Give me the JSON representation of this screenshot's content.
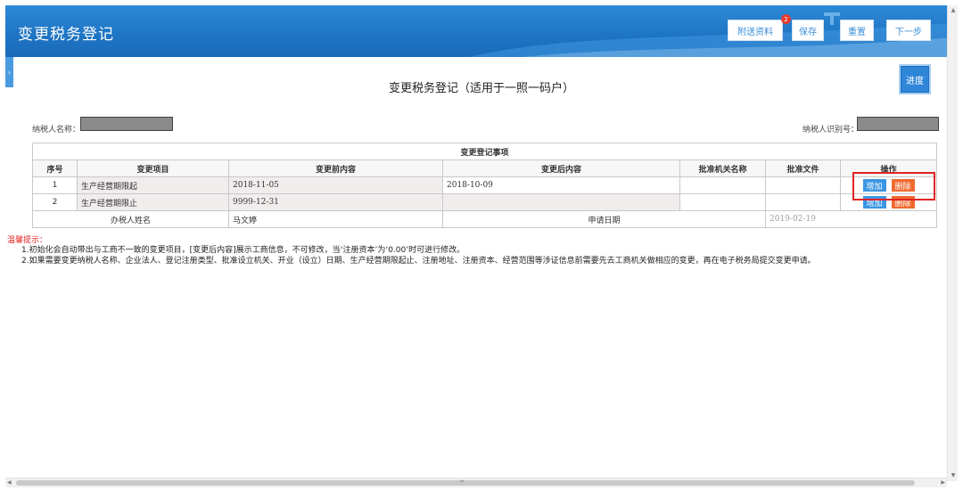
{
  "header": {
    "title": "变更税务登记",
    "badge_count": "2",
    "buttons": {
      "attach": "附送资料",
      "save": "保存",
      "reset": "重置",
      "next": "下一步"
    }
  },
  "progress_label": "进度",
  "form_title": "变更税务登记（适用于一照一码户）",
  "taxpayer_name_label": "纳税人名称：",
  "taxpayer_id_label": "纳税人识别号：",
  "table": {
    "caption": "变更登记事项",
    "columns": [
      "序号",
      "变更项目",
      "变更前内容",
      "变更后内容",
      "批准机关名称",
      "批准文件",
      "操作"
    ],
    "rows": [
      {
        "no": "1",
        "item": "生产经营期限起",
        "before": "2018-11-05",
        "after": "2018-10-09",
        "authority": "",
        "doc": ""
      },
      {
        "no": "2",
        "item": "生产经营期限止",
        "before": "9999-12-31",
        "after": "",
        "authority": "",
        "doc": ""
      }
    ],
    "add_label": "增加",
    "delete_label": "删除",
    "footer": {
      "handler_label": "办税人姓名",
      "handler_name": "马文婷",
      "date_label": "申请日期",
      "date_value": "2019-02-19"
    }
  },
  "tips": {
    "title": "温馨提示：",
    "lines": [
      "1.初始化会自动带出与工商不一致的变更项目，[变更后内容]展示工商信息，不可修改，当‘注册资本’为‘0.00’时可进行修改。",
      "2.如果需要变更纳税人名称、企业法人、登记注册类型、批准设立机关、开业（设立）日期、生产经营期限起止、注册地址、注册资本、经营范围等涉证信息前需要先去工商机关做相应的变更，再在电子税务局提交变更申请。"
    ]
  },
  "colors": {
    "header_blue": "#1e74c4",
    "add_blue": "#3b96e3",
    "delete_orange": "#f06a2e",
    "tip_red": "#e02424"
  }
}
